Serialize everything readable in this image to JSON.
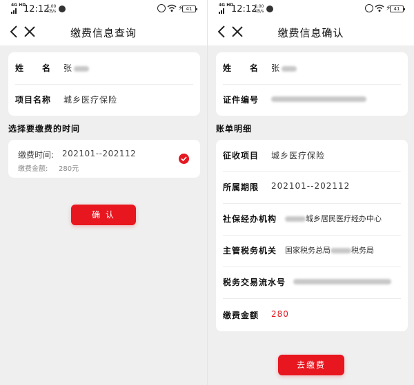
{
  "status_bar": {
    "signal": "4G HD",
    "time": "12:12",
    "left_speed_value": "1.00",
    "right_speed_value": "0.00",
    "speed_unit": "KB/s",
    "battery": "41"
  },
  "query_screen": {
    "title": "缴费信息查询",
    "info": {
      "name_label": "姓　　名",
      "name_value": "张",
      "project_label": "项目名称",
      "project_value": "城乡医疗保险"
    },
    "section_title": "选择要缴费的时间",
    "period_option": {
      "period_label": "缴费时间:",
      "period_value": "202101--202112",
      "amount_label": "缴费金额:",
      "amount_value": "280元",
      "selected": true
    },
    "confirm_button": "确 认"
  },
  "confirm_screen": {
    "title": "缴费信息确认",
    "info": {
      "name_label": "姓　　名",
      "name_value": "张",
      "id_label": "证件编号"
    },
    "section_title": "账单明细",
    "bill": {
      "collection_item_label": "征收项目",
      "collection_item_value": "城乡医疗保险",
      "period_label": "所属期限",
      "period_value": "202101--202112",
      "agency_label": "社保经办机构",
      "agency_value": "城乡居民医疗经办中心",
      "tax_authority_label": "主管税务机关",
      "tax_authority_prefix": "国家税务总局",
      "tax_authority_suffix": "税务局",
      "serial_label": "税务交易流水号",
      "amount_label": "缴费金额",
      "amount_value": "280"
    },
    "pay_button": "去缴费"
  },
  "colors": {
    "accent": "#e8161f",
    "background": "#efefef",
    "card": "#ffffff"
  }
}
